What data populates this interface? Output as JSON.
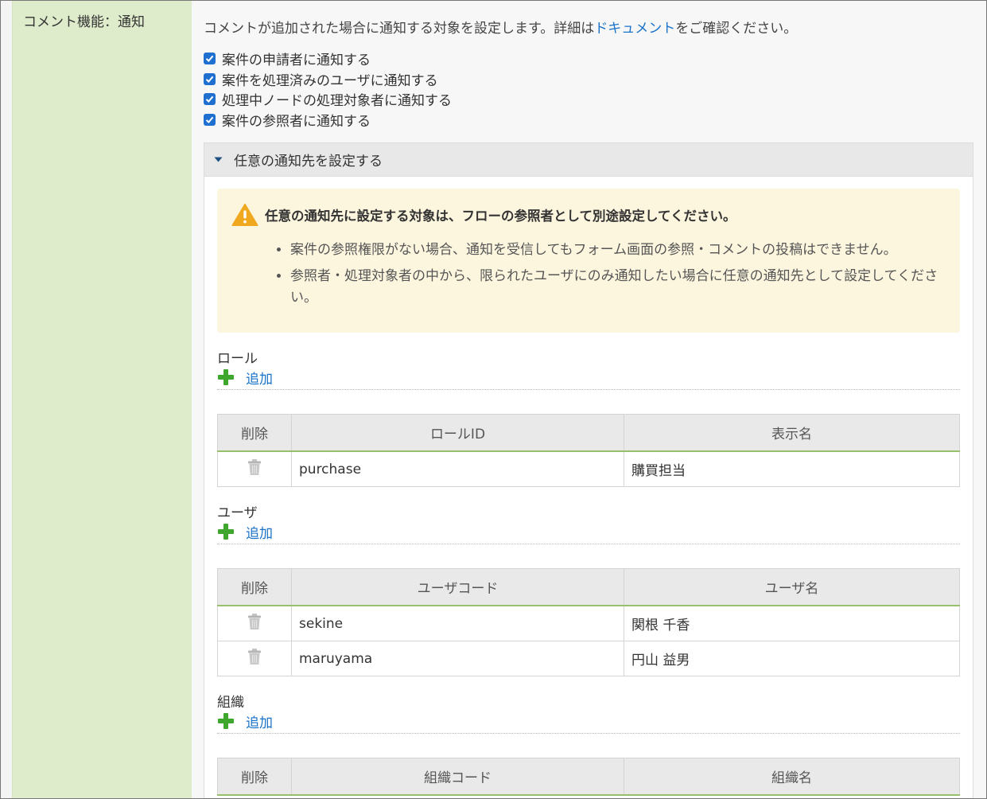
{
  "label": "コメント機能：通知",
  "description": {
    "before": "コメントが追加された場合に通知する対象を設定します。詳細は",
    "link": "ドキュメント",
    "after": "をご確認ください。"
  },
  "checkboxes": [
    {
      "label": "案件の申請者に通知する",
      "checked": true
    },
    {
      "label": "案件を処理済みのユーザに通知する",
      "checked": true
    },
    {
      "label": "処理中ノードの処理対象者に通知する",
      "checked": true
    },
    {
      "label": "案件の参照者に通知する",
      "checked": true
    }
  ],
  "panel": {
    "title": "任意の通知先を設定する",
    "alert": {
      "title": "任意の通知先に設定する対象は、フローの参照者として別途設定してください。",
      "items": [
        "案件の参照権限がない場合、通知を受信してもフォーム画面の参照・コメントの投稿はできません。",
        "参照者・処理対象者の中から、限られたユーザにのみ通知したい場合に任意の通知先として設定してください。"
      ]
    }
  },
  "add_label": "追加",
  "delete_header": "削除",
  "role": {
    "title": "ロール",
    "columns": [
      "ロールID",
      "表示名"
    ],
    "rows": [
      [
        "purchase",
        "購買担当"
      ]
    ]
  },
  "user": {
    "title": "ユーザ",
    "columns": [
      "ユーザコード",
      "ユーザ名"
    ],
    "rows": [
      [
        "sekine",
        "関根 千香"
      ],
      [
        "maruyama",
        "円山 益男"
      ]
    ]
  },
  "org": {
    "title": "組織",
    "columns": [
      "組織コード",
      "組織名"
    ],
    "rows": []
  },
  "colors": {
    "accent": "#1a73c8",
    "label_bg": "#dfeccb",
    "alert_bg": "#fdf6df",
    "header_underline": "#98bf6b"
  },
  "icons": {
    "checkbox": "check-icon",
    "expand": "triangle-down-icon",
    "warning": "warning-icon",
    "add": "plus-icon",
    "delete": "trash-icon"
  }
}
